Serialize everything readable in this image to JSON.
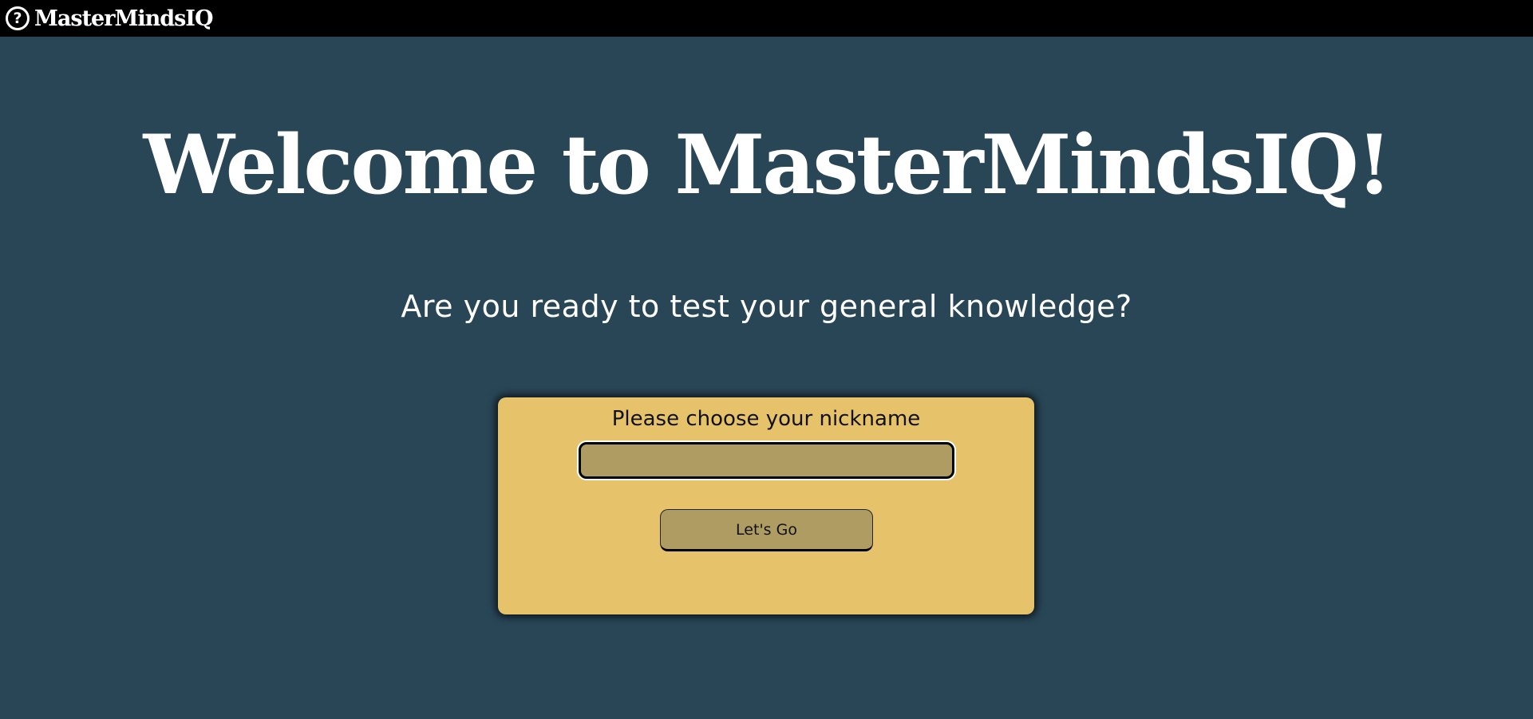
{
  "navbar": {
    "icon": "question-circle-icon",
    "icon_glyph": "?",
    "brand": "MasterMindsIQ"
  },
  "main": {
    "title": "Welcome to MasterMindsIQ!",
    "subtitle": "Are you ready to test your general knowledge?"
  },
  "form": {
    "label": "Please choose your nickname",
    "nickname_value": "",
    "nickname_placeholder": "",
    "submit_label": "Let's Go"
  },
  "colors": {
    "background": "#294657",
    "navbar": "#000000",
    "card": "#e6c36a",
    "control": "#af9c62",
    "text_light": "#ffffff"
  }
}
